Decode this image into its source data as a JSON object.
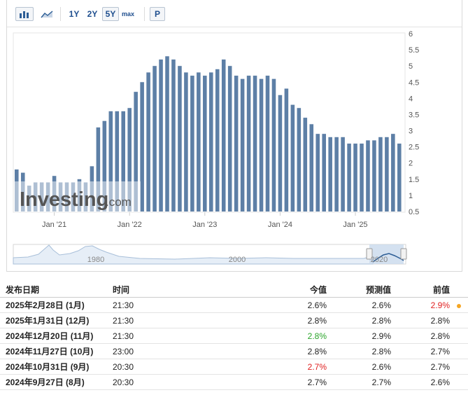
{
  "toolbar": {
    "bar_icon": "bar-chart-icon",
    "area_icon": "area-chart-icon",
    "ranges": [
      "1Y",
      "2Y",
      "5Y",
      "max"
    ],
    "active_range": "5Y",
    "p_label": "P"
  },
  "watermark": {
    "text": "Investing",
    "suffix": ".com"
  },
  "chart_data": {
    "type": "bar",
    "ylim": [
      0.5,
      6
    ],
    "yticks": [
      "6",
      "5.5",
      "5",
      "4.5",
      "4",
      "3.5",
      "3",
      "2.5",
      "2",
      "1.5",
      "1",
      "0.5"
    ],
    "xtick_labels": [
      "Jan '21",
      "Jan '22",
      "Jan '23",
      "Jan '24",
      "Jan '25"
    ],
    "bar_color": "#5d7fa6",
    "values": [
      1.8,
      1.7,
      1.3,
      1.4,
      1.4,
      1.4,
      1.6,
      1.4,
      1.4,
      1.4,
      1.5,
      1.4,
      1.9,
      3.1,
      3.3,
      3.6,
      3.6,
      3.6,
      3.7,
      4.2,
      4.5,
      4.8,
      5.0,
      5.2,
      5.3,
      5.2,
      5.0,
      4.8,
      4.7,
      4.8,
      4.7,
      4.8,
      4.9,
      5.2,
      5.0,
      4.7,
      4.6,
      4.7,
      4.7,
      4.6,
      4.7,
      4.6,
      4.1,
      4.3,
      3.8,
      3.7,
      3.4,
      3.2,
      2.9,
      2.9,
      2.8,
      2.8,
      2.8,
      2.6,
      2.6,
      2.6,
      2.7,
      2.7,
      2.8,
      2.8,
      2.9,
      2.6
    ],
    "navigator": {
      "labels": [
        "1980",
        "2000",
        "2020"
      ]
    }
  },
  "table": {
    "headers": [
      "发布日期",
      "时间",
      "今值",
      "预测值",
      "前值"
    ],
    "rows": [
      {
        "date": "2025年2月28日 (1月)",
        "time": "21:30",
        "actual": "2.6%",
        "forecast": "2.6%",
        "previous": "2.9%",
        "actual_color": "#222222",
        "previous_color": "#e02020",
        "dot": true
      },
      {
        "date": "2025年1月31日 (12月)",
        "time": "21:30",
        "actual": "2.8%",
        "forecast": "2.8%",
        "previous": "2.8%",
        "actual_color": "#222222",
        "previous_color": "#222222",
        "dot": false
      },
      {
        "date": "2024年12月20日 (11月)",
        "time": "21:30",
        "actual": "2.8%",
        "forecast": "2.9%",
        "previous": "2.8%",
        "actual_color": "#2aa52a",
        "previous_color": "#222222",
        "dot": false
      },
      {
        "date": "2024年11月27日 (10月)",
        "time": "23:00",
        "actual": "2.8%",
        "forecast": "2.8%",
        "previous": "2.7%",
        "actual_color": "#222222",
        "previous_color": "#222222",
        "dot": false
      },
      {
        "date": "2024年10月31日 (9月)",
        "time": "20:30",
        "actual": "2.7%",
        "forecast": "2.6%",
        "previous": "2.7%",
        "actual_color": "#e02020",
        "previous_color": "#222222",
        "dot": false
      },
      {
        "date": "2024年9月27日 (8月)",
        "time": "20:30",
        "actual": "2.7%",
        "forecast": "2.7%",
        "previous": "2.6%",
        "actual_color": "#222222",
        "previous_color": "#222222",
        "dot": false
      }
    ]
  }
}
